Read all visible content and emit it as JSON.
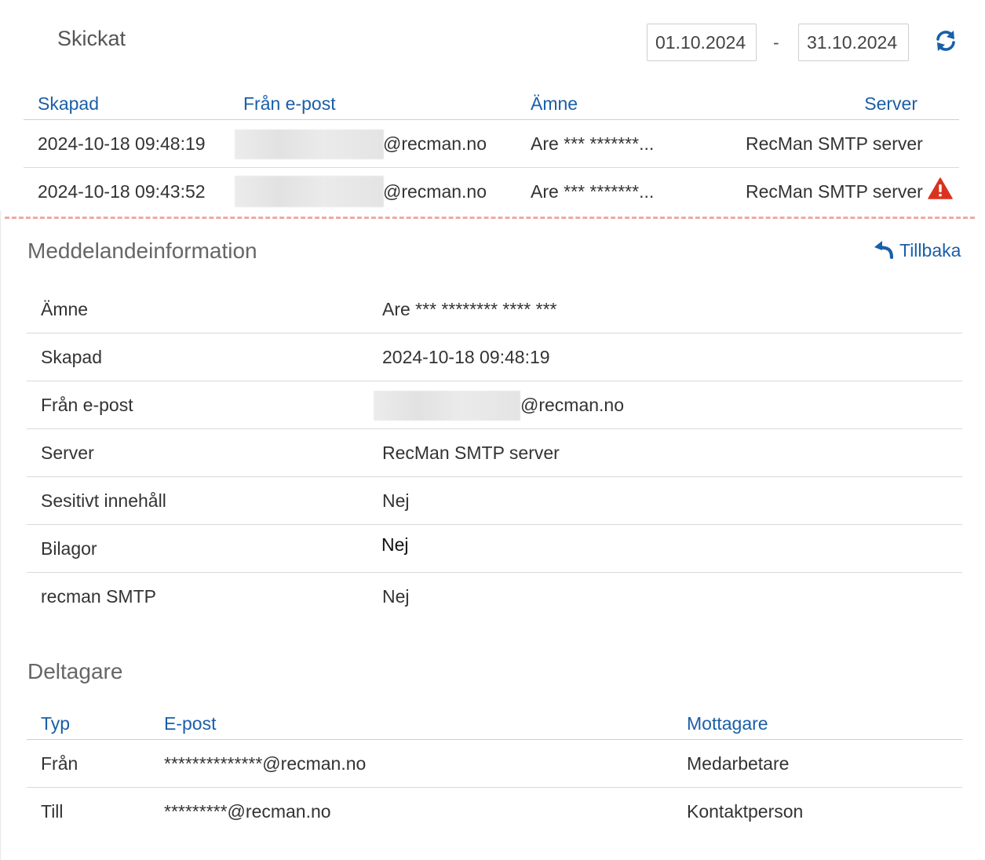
{
  "header": {
    "title": "Skickat",
    "date_from": "01.10.2024",
    "date_separator": "-",
    "date_to": "31.10.2024",
    "refresh_icon": "refresh-icon"
  },
  "list": {
    "columns": [
      "Skapad",
      "Från e-post",
      "Ämne",
      "Server"
    ],
    "rows": [
      {
        "created": "2024-10-18 09:48:19",
        "email_domain": "@recman.no",
        "subject": "Are *** *******...",
        "server": "RecMan SMTP server",
        "warning": false
      },
      {
        "created": "2024-10-18 09:43:52",
        "email_domain": "@recman.no",
        "subject": "Are *** *******...",
        "server": "RecMan SMTP server",
        "warning": true
      }
    ]
  },
  "details": {
    "title": "Meddelandeinformation",
    "back_label": "Tillbaka",
    "rows": [
      {
        "label": "Ämne",
        "value": "Are *** ******** **** ***"
      },
      {
        "label": "Skapad",
        "value": "2024-10-18 09:48:19"
      },
      {
        "label": "Från e-post",
        "value": "@recman.no"
      },
      {
        "label": "Server",
        "value": "RecMan SMTP server"
      },
      {
        "label": "Sesitivt innehåll",
        "value": "Nej"
      },
      {
        "label": "Bilagor",
        "value": "Nej"
      },
      {
        "label": "recman SMTP",
        "value": "Nej"
      }
    ]
  },
  "participants": {
    "title": "Deltagare",
    "columns": [
      "Typ",
      "E-post",
      "Mottagare"
    ],
    "rows": [
      {
        "type": "Från",
        "email": "**************@recman.no",
        "recipient": "Medarbetare"
      },
      {
        "type": "Till",
        "email": "*********@recman.no",
        "recipient": "Kontaktperson"
      }
    ]
  },
  "colors": {
    "link": "#1a5fa8",
    "warning": "#d9331f",
    "dashed_divider": "#f0a8a8"
  }
}
